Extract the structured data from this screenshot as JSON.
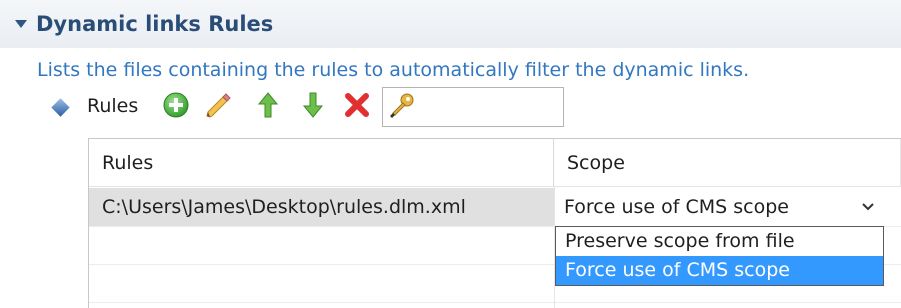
{
  "section": {
    "title": "Dynamic links Rules",
    "description": "Lists the files containing the rules to automatically filter the dynamic links."
  },
  "toolbar": {
    "label": "Rules",
    "icons": [
      "add-icon",
      "pencil-icon",
      "arrow-up-icon",
      "arrow-down-icon",
      "delete-icon",
      "key-filter-icon"
    ],
    "filter_value": ""
  },
  "table": {
    "columns": [
      "Rules",
      "Scope"
    ],
    "rows": [
      {
        "rule": "C:\\Users\\James\\Desktop\\rules.dlm.xml",
        "scope": "Force use of CMS scope"
      }
    ]
  },
  "scope_dropdown": {
    "options": [
      "Preserve scope from file",
      "Force use of CMS scope"
    ],
    "selected": "Force use of CMS scope"
  },
  "colors": {
    "title": "#2a4d78",
    "description": "#3277c0",
    "selection": "#3399ff",
    "row_highlight": "#e0e0e0"
  }
}
